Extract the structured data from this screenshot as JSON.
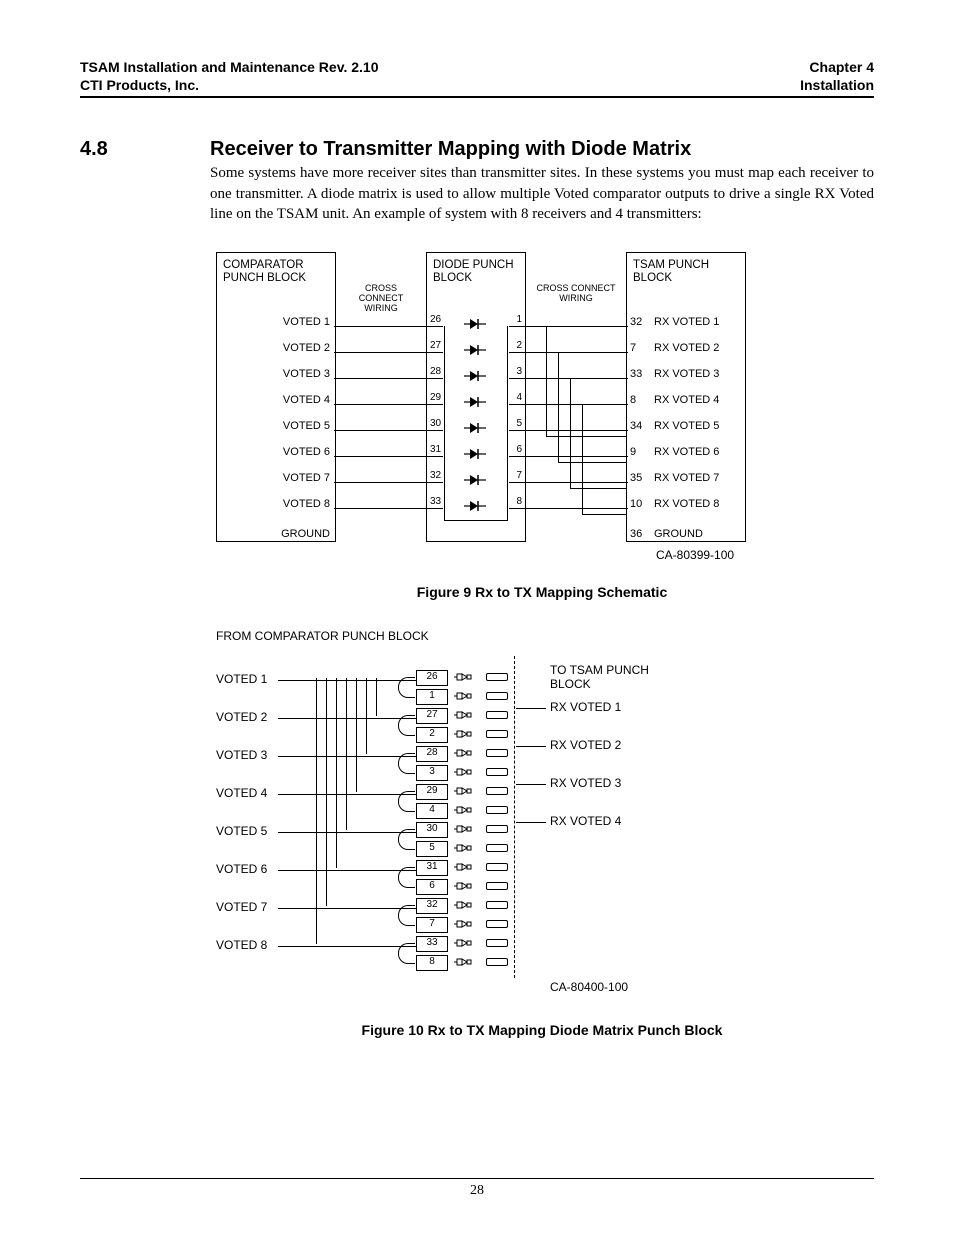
{
  "header": {
    "left1": "TSAM Installation and Maintenance Rev. 2.10",
    "left2": "CTI Products, Inc.",
    "right1": "Chapter 4",
    "right2": "Installation"
  },
  "section": {
    "number": "4.8",
    "title": "Receiver to Transmitter Mapping with Diode Matrix",
    "body": "Some systems have more receiver sites than transmitter sites.  In these systems you must map each receiver to one transmitter.  A diode matrix is used to allow multiple Voted comparator outputs to drive a single RX Voted line on the TSAM unit.  An example of system with 8 receivers and 4 transmitters:"
  },
  "fig1": {
    "boxA_title": "COMPARATOR PUNCH BLOCK",
    "boxB_title": "DIODE PUNCH BLOCK",
    "boxC_title": "TSAM PUNCH BLOCK",
    "xconnect": "CROSS CONNECT WIRING",
    "rows": [
      {
        "a": "VOTED 1",
        "pl": "26",
        "pr": "1",
        "cn": "32",
        "c": "RX VOTED 1"
      },
      {
        "a": "VOTED 2",
        "pl": "27",
        "pr": "2",
        "cn": "7",
        "c": "RX VOTED 2"
      },
      {
        "a": "VOTED 3",
        "pl": "28",
        "pr": "3",
        "cn": "33",
        "c": "RX VOTED 3"
      },
      {
        "a": "VOTED 4",
        "pl": "29",
        "pr": "4",
        "cn": "8",
        "c": "RX VOTED 4"
      },
      {
        "a": "VOTED 5",
        "pl": "30",
        "pr": "5",
        "cn": "34",
        "c": "RX VOTED 5"
      },
      {
        "a": "VOTED 6",
        "pl": "31",
        "pr": "6",
        "cn": "9",
        "c": "RX VOTED 6"
      },
      {
        "a": "VOTED 7",
        "pl": "32",
        "pr": "7",
        "cn": "35",
        "c": "RX VOTED 7"
      },
      {
        "a": "VOTED 8",
        "pl": "33",
        "pr": "8",
        "cn": "10",
        "c": "RX VOTED 8"
      }
    ],
    "ground_row": {
      "a": "GROUND",
      "cn": "36",
      "c": "GROUND"
    },
    "part": "CA-80399-100",
    "caption": "Figure 9   Rx to TX Mapping Schematic"
  },
  "fig2": {
    "hdrL": "FROM COMPARATOR PUNCH BLOCK",
    "hdrR": "TO TSAM PUNCH BLOCK",
    "left": [
      "VOTED 1",
      "VOTED 2",
      "VOTED 3",
      "VOTED 4",
      "VOTED 5",
      "VOTED 6",
      "VOTED 7",
      "VOTED 8"
    ],
    "right": [
      "RX VOTED 1",
      "RX VOTED 2",
      "RX VOTED 3",
      "RX VOTED 4"
    ],
    "slots": [
      "26",
      "1",
      "27",
      "2",
      "28",
      "3",
      "29",
      "4",
      "30",
      "5",
      "31",
      "6",
      "32",
      "7",
      "33",
      "8"
    ],
    "part": "CA-80400-100",
    "caption": "Figure 10   Rx to TX Mapping Diode Matrix Punch Block"
  },
  "page_number": "28"
}
